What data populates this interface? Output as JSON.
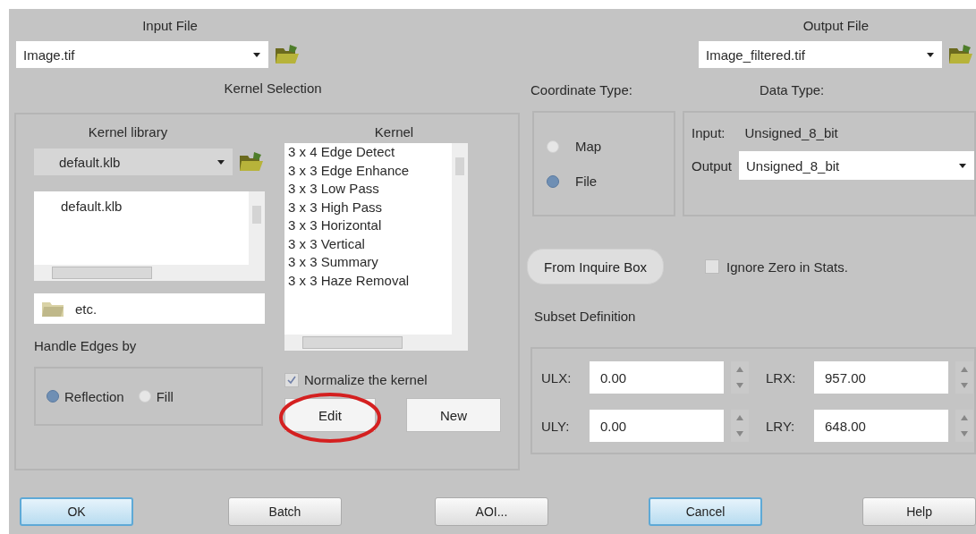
{
  "input_file": {
    "label": "Input File",
    "value": "Image.tif"
  },
  "output_file": {
    "label": "Output File",
    "value": "Image_filtered.tif"
  },
  "kernel_selection": {
    "title": "Kernel Selection",
    "library_label": "Kernel library",
    "library_combo": "default.klb",
    "library_list": [
      "default.klb"
    ],
    "directory": "etc.",
    "kernel_label": "Kernel",
    "kernels": [
      "3 x 4 Edge Detect",
      "3 x 3 Edge Enhance",
      "3 x 3 Low Pass",
      "3 x 3 High Pass",
      "3 x 3 Horizontal",
      "3 x 3 Vertical",
      "3 x 3 Summary",
      "3 x 3 Haze Removal"
    ],
    "normalize": {
      "label": "Normalize the kernel",
      "checked": true
    },
    "edit_button": "Edit",
    "new_button": "New"
  },
  "handle_edges": {
    "title": "Handle Edges by",
    "options": [
      {
        "label": "Reflection",
        "selected": true
      },
      {
        "label": "Fill",
        "selected": false
      }
    ]
  },
  "coordinate_type": {
    "title": "Coordinate Type:",
    "options": [
      {
        "label": "Map",
        "selected": false
      },
      {
        "label": "File",
        "selected": true
      }
    ]
  },
  "data_type": {
    "title": "Data Type:",
    "input_label": "Input:",
    "input_value": "Unsigned_8_bit",
    "output_label": "Output",
    "output_value": "Unsigned_8_bit"
  },
  "from_inquire_button": "From Inquire Box",
  "ignore_zero": {
    "label": "Ignore Zero in Stats.",
    "checked": false
  },
  "subset": {
    "title": "Subset Definition",
    "fields": [
      {
        "label": "ULX:",
        "value": "0.00"
      },
      {
        "label": "LRX:",
        "value": "957.00"
      },
      {
        "label": "ULY:",
        "value": "0.00"
      },
      {
        "label": "LRY:",
        "value": "648.00"
      }
    ]
  },
  "buttons": [
    {
      "label": "OK",
      "focused": true
    },
    {
      "label": "Batch",
      "focused": false
    },
    {
      "label": "AOI...",
      "focused": false
    },
    {
      "label": "Cancel",
      "focused": true
    },
    {
      "label": "Help",
      "focused": false
    }
  ]
}
